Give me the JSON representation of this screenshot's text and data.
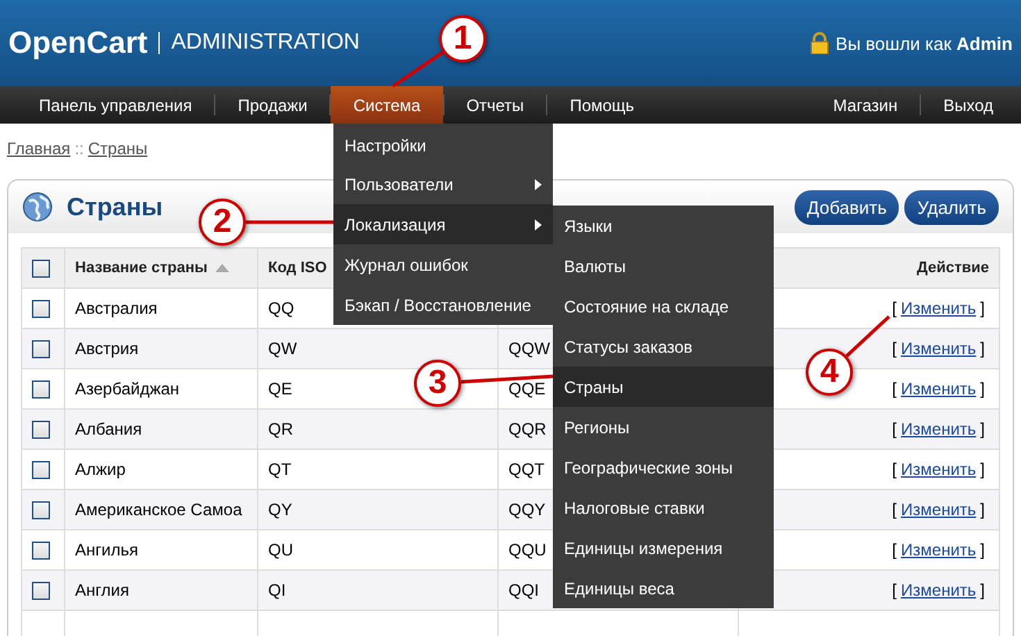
{
  "header": {
    "logo": "OpenCart",
    "subtitle": "ADMINISTRATION",
    "login_text": "Вы вошли как **Admin**"
  },
  "nav": {
    "left": [
      {
        "label": "Панель управления",
        "selected": false
      },
      {
        "label": "Продажи",
        "selected": false
      },
      {
        "label": "Система",
        "selected": true
      },
      {
        "label": "Отчеты",
        "selected": false
      },
      {
        "label": "Помощь",
        "selected": false
      }
    ],
    "right": [
      {
        "label": "Магазин",
        "selected": false
      },
      {
        "label": "Выход",
        "selected": false
      }
    ]
  },
  "breadcrumb": [
    "Главная",
    "::",
    "Страны"
  ],
  "panel": {
    "title": "Страны",
    "buttons": [
      "Добавить",
      "Удалить"
    ]
  },
  "table": {
    "header_checked": false,
    "columns": {
      "name": "Название страны",
      "iso2": "Код ISO",
      "action": "Действие"
    },
    "rows": [
      {
        "checked": false,
        "name": "Австралия",
        "iso2": "QQ",
        "open": "[",
        "action": "Изменить",
        "close": "]"
      },
      {
        "checked": false,
        "name": "Австрия",
        "iso2": "QW",
        "iso3": "QQW",
        "open": "[",
        "action": "Изменить",
        "close": "]"
      },
      {
        "checked": false,
        "name": "Азербайджан",
        "iso2": "QE",
        "iso3": "QQE",
        "open": "[",
        "action": "Изменить",
        "close": "]"
      },
      {
        "checked": false,
        "name": "Албания",
        "iso2": "QR",
        "iso3": "QQR",
        "open": "[",
        "action": "Изменить",
        "close": "]"
      },
      {
        "checked": false,
        "name": "Алжир",
        "iso2": "QT",
        "iso3": "QQT",
        "open": "[",
        "action": "Изменить",
        "close": "]"
      },
      {
        "checked": false,
        "name": "Американское Самоа",
        "iso2": "QY",
        "iso3": "QQY",
        "open": "[",
        "action": "Изменить",
        "close": "]"
      },
      {
        "checked": false,
        "name": "Ангилья",
        "iso2": "QU",
        "iso3": "QQU",
        "open": "[",
        "action": "Изменить",
        "close": "]"
      },
      {
        "checked": false,
        "name": "Англия",
        "iso2": "QI",
        "iso3": "QQI",
        "open": "[",
        "action": "Изменить",
        "close": "]"
      }
    ]
  },
  "system_menu": [
    {
      "label": "Настройки",
      "submenu": false,
      "selected": false
    },
    {
      "label": "Пользователи",
      "submenu": true,
      "selected": false
    },
    {
      "label": "Локализация",
      "submenu": true,
      "selected": true
    },
    {
      "label": "Журнал ошибок",
      "submenu": false,
      "selected": false
    },
    {
      "label": "Бэкап / Восстановление",
      "submenu": false,
      "selected": false
    }
  ],
  "localization_menu": [
    {
      "label": "Языки",
      "selected": false
    },
    {
      "label": "Валюты",
      "selected": false
    },
    {
      "label": "Состояние на складе",
      "selected": false
    },
    {
      "label": "Статусы заказов",
      "selected": false
    },
    {
      "label": "Страны",
      "selected": true
    },
    {
      "label": "Регионы",
      "selected": false
    },
    {
      "label": "Географические зоны",
      "selected": false
    },
    {
      "label": "Налоговые ставки",
      "selected": false
    },
    {
      "label": "Единицы измерения",
      "selected": false
    },
    {
      "label": "Единицы веса",
      "selected": false
    }
  ],
  "callouts": [
    "1",
    "2",
    "3",
    "4"
  ]
}
